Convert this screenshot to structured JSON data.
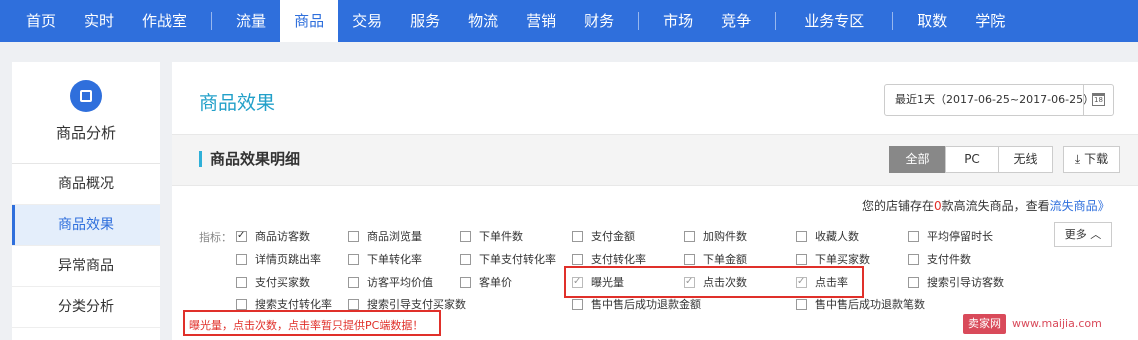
{
  "nav": {
    "items": [
      "首页",
      "实时",
      "作战室",
      "流量",
      "商品",
      "交易",
      "服务",
      "物流",
      "营销",
      "财务",
      "市场",
      "竞争",
      "业务专区",
      "取数",
      "学院"
    ],
    "active": "商品"
  },
  "sidebar": {
    "title": "商品分析",
    "items": [
      {
        "label": "商品概况"
      },
      {
        "label": "商品效果"
      },
      {
        "label": "异常商品"
      },
      {
        "label": "分类分析"
      }
    ],
    "active_index": 1
  },
  "header": {
    "title": "商品效果",
    "date_range": "最近1天（2017-06-25~2017-06-25）"
  },
  "section": {
    "title": "商品效果明细",
    "tabs": [
      "全部",
      "PC",
      "无线"
    ],
    "active_tab": "全部",
    "download_label": "下载"
  },
  "notice": {
    "prefix": "您的店铺存在",
    "count": "0",
    "middle": "款高流失商品，查看",
    "link": "流失商品",
    "suffix": "》"
  },
  "metrics": {
    "label": "指标：",
    "more_label": "更多",
    "rows": [
      [
        {
          "label": "商品访客数",
          "checked": true
        },
        {
          "label": "商品浏览量",
          "checked": false
        },
        {
          "label": "下单件数",
          "checked": false
        },
        {
          "label": "支付金额",
          "checked": false
        },
        {
          "label": "加购件数",
          "checked": false
        },
        {
          "label": "收藏人数",
          "checked": false
        },
        {
          "label": "平均停留时长",
          "checked": false
        }
      ],
      [
        {
          "label": "详情页跳出率",
          "checked": false
        },
        {
          "label": "下单转化率",
          "checked": false
        },
        {
          "label": "下单支付转化率",
          "checked": false
        },
        {
          "label": "支付转化率",
          "checked": false
        },
        {
          "label": "下单金额",
          "checked": false
        },
        {
          "label": "下单买家数",
          "checked": false
        },
        {
          "label": "支付件数",
          "checked": false
        }
      ],
      [
        {
          "label": "支付买家数",
          "checked": false
        },
        {
          "label": "访客平均价值",
          "checked": false
        },
        {
          "label": "客单价",
          "checked": false
        },
        {
          "label": "曝光量",
          "checked": true,
          "disabled": true
        },
        {
          "label": "点击次数",
          "checked": true,
          "disabled": true
        },
        {
          "label": "点击率",
          "checked": true,
          "disabled": true
        },
        {
          "label": "搜索引导访客数",
          "checked": false
        }
      ],
      [
        {
          "label": "搜索支付转化率",
          "checked": false
        },
        {
          "label": "搜索引导支付买家数",
          "checked": false
        },
        {
          "label": "售中售后成功退款金额",
          "checked": false
        },
        {
          "label": "售中售后成功退款笔数",
          "checked": false
        }
      ]
    ]
  },
  "warning": "曝光量，点击次数，点击率暂只提供PC端数据！",
  "watermark": {
    "brand": "卖家网",
    "url": "www.maijia.com"
  },
  "colors": {
    "primary": "#2f6fdc",
    "title": "#22a0c9",
    "alert": "#e0302a"
  }
}
